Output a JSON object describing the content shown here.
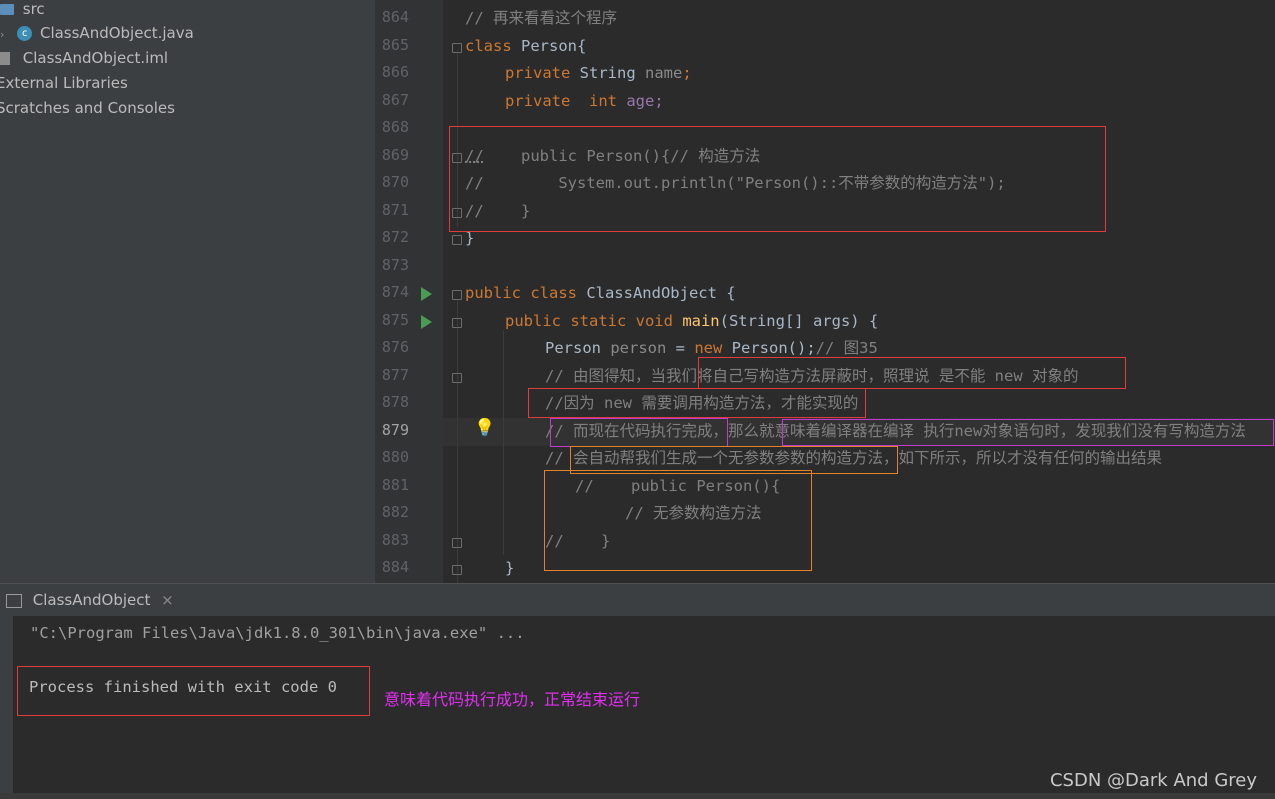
{
  "project_tree": [
    {
      "label": "src",
      "icon": "folder-icon"
    },
    {
      "label": "ClassAndObject.java",
      "icon": "java-class-icon"
    },
    {
      "label": "ClassAndObject.iml",
      "icon": "module-file-icon"
    },
    {
      "label": "External Libraries",
      "icon": "library-icon"
    },
    {
      "label": "Scratches and Consoles",
      "icon": "scratches-icon"
    }
  ],
  "editor": {
    "line_numbers": [
      "864",
      "865",
      "866",
      "867",
      "868",
      "869",
      "870",
      "871",
      "872",
      "873",
      "874",
      "875",
      "876",
      "877",
      "878",
      "879",
      "880",
      "881",
      "882",
      "883",
      "884"
    ],
    "current_line": "879",
    "code": {
      "l864": "// 再来看看这个程序",
      "l865": [
        "class",
        " Person{"
      ],
      "l866": [
        "private",
        " String ",
        "name",
        ";"
      ],
      "l867": [
        "private",
        "  int",
        " age;"
      ],
      "l869": [
        "//",
        "    public Person(){// 构造方法"
      ],
      "l870": "//        System.out.println(\"Person()::不带参数的构造方法\");",
      "l871": "//    }",
      "l872": "}",
      "l874": [
        "public class",
        " ClassAndObject {"
      ],
      "l875": [
        "public static void ",
        "main",
        "(String[] args) {"
      ],
      "l876": [
        "Person ",
        "person",
        " = ",
        "new",
        " Person();",
        "// 图35"
      ],
      "l877": "// 由图得知，当我们将自己写构造方法屏蔽时，照理说 是不能 new 对象的",
      "l878": "//因为 new 需要调用构造方法，才能实现的",
      "l879": "// 而现在代码执行完成，那么就意味着编译器在编译 执行new对象语句时，发现我们没有写构造方法",
      "l880": "// 会自动帮我们生成一个无参数参数的构造方法，如下所示，所以才没有任何的输出结果",
      "l881": "//    public Person(){",
      "l882": "// 无参数构造方法",
      "l883": "//    }",
      "l884": "}"
    }
  },
  "run_panel": {
    "tab_label": "ClassAndObject",
    "close_glyph": "×",
    "command": "\"C:\\Program Files\\Java\\jdk1.8.0_301\\bin\\java.exe\" ...",
    "exit_message": "Process finished with exit code 0",
    "annotation": "意味着代码执行成功，正常结束运行"
  },
  "watermark": "CSDN @Dark And Grey",
  "colors": {
    "keyword": "#cc7832",
    "method": "#ffc66d",
    "comment": "#808080",
    "field": "#9876aa",
    "annotation": "#e12ff0"
  }
}
